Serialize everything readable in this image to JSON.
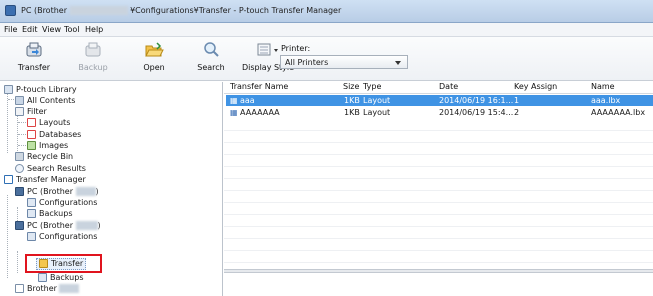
{
  "window": {
    "title_start": "PC (Brother",
    "title_mid": "¥Configurations¥Transfer - P-touch Transfer Manager"
  },
  "menu": [
    "File",
    "Edit",
    "View",
    "Tool",
    "Help"
  ],
  "toolbar": {
    "transfer": "Transfer",
    "backup": "Backup",
    "open": "Open",
    "search": "Search",
    "display_style": "Display Style",
    "printer_label": "Printer:",
    "printer_value": "All Printers"
  },
  "tree": {
    "library": "P-touch Library",
    "all_contents": "All Contents",
    "filter": "Filter",
    "layouts": "Layouts",
    "databases": "Databases",
    "images": "Images",
    "recycle_bin": "Recycle Bin",
    "search_results": "Search Results",
    "transfer_manager": "Transfer Manager",
    "pc_brother_1": "PC (Brother",
    "paren_close_1": ")",
    "configurations_1": "Configurations",
    "backups_1": "Backups",
    "pc_brother_2": "PC (Brother",
    "paren_close_2": ")",
    "configurations_2": "Configurations",
    "transfer": "Transfer",
    "backups_2": "Backups",
    "brother_3": "Brother"
  },
  "list": {
    "columns": [
      "Transfer Name",
      "Size",
      "Type",
      "Date",
      "Key Assign",
      "Name"
    ],
    "rows": [
      {
        "transfer_name": "aaa",
        "size": "1KB",
        "type": "Layout",
        "date": "2014/06/19 16:1...",
        "key_assign": "1",
        "name": "aaa.lbx"
      },
      {
        "transfer_name": "AAAAAAA",
        "size": "1KB",
        "type": "Layout",
        "date": "2014/06/19 15:4...",
        "key_assign": "2",
        "name": "AAAAAAA.lbx"
      }
    ]
  },
  "colors": {
    "selection": "#3f93e4",
    "highlight_box": "#e0141e",
    "titlebar": "#c4d6ec"
  }
}
